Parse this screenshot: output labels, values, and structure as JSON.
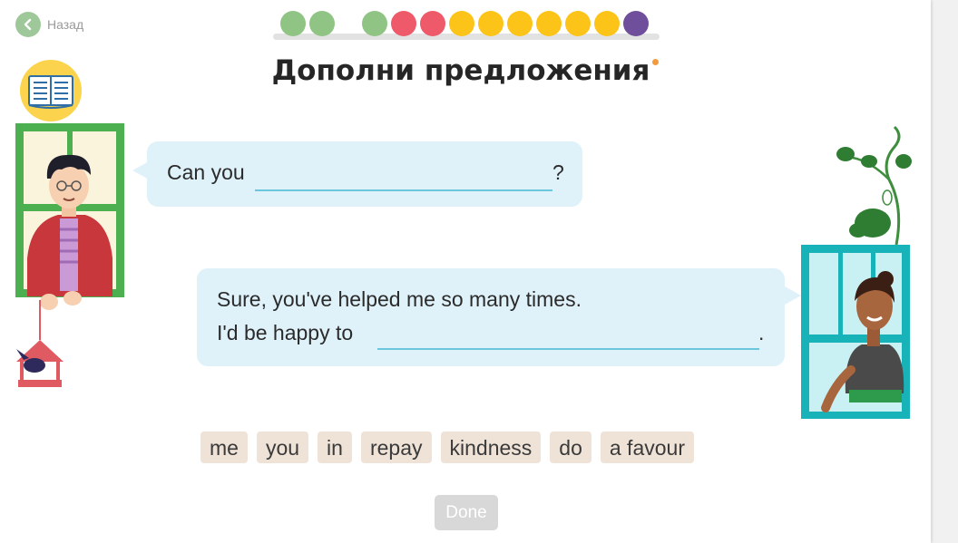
{
  "nav": {
    "back_label": "Назад"
  },
  "progress": {
    "dots": [
      {
        "color": "#8fc484"
      },
      {
        "color": "#8fc484"
      },
      {
        "color": "#8fc484"
      },
      {
        "color": "#ee5a6a"
      },
      {
        "color": "#ee5a6a"
      },
      {
        "color": "#fcc419"
      },
      {
        "color": "#fcc419"
      },
      {
        "color": "#fcc419"
      },
      {
        "color": "#fcc419"
      },
      {
        "color": "#fcc419"
      },
      {
        "color": "#fcc419"
      },
      {
        "color": "#6f4f9c"
      }
    ]
  },
  "title": "Дополни предложения",
  "dialogue": {
    "line1_before": "Can you",
    "line1_after": "?",
    "line2_text": "Sure, you've helped me so many times.",
    "line3_before": "I'd be happy to",
    "line3_after": "."
  },
  "word_bank": [
    "me",
    "you",
    "in",
    "repay",
    "kindness",
    "do",
    "a favour"
  ],
  "done_label": "Done",
  "colors": {
    "accent": "#6cc6dc",
    "bubble": "#dff1f9",
    "chip": "#efe3d8"
  }
}
